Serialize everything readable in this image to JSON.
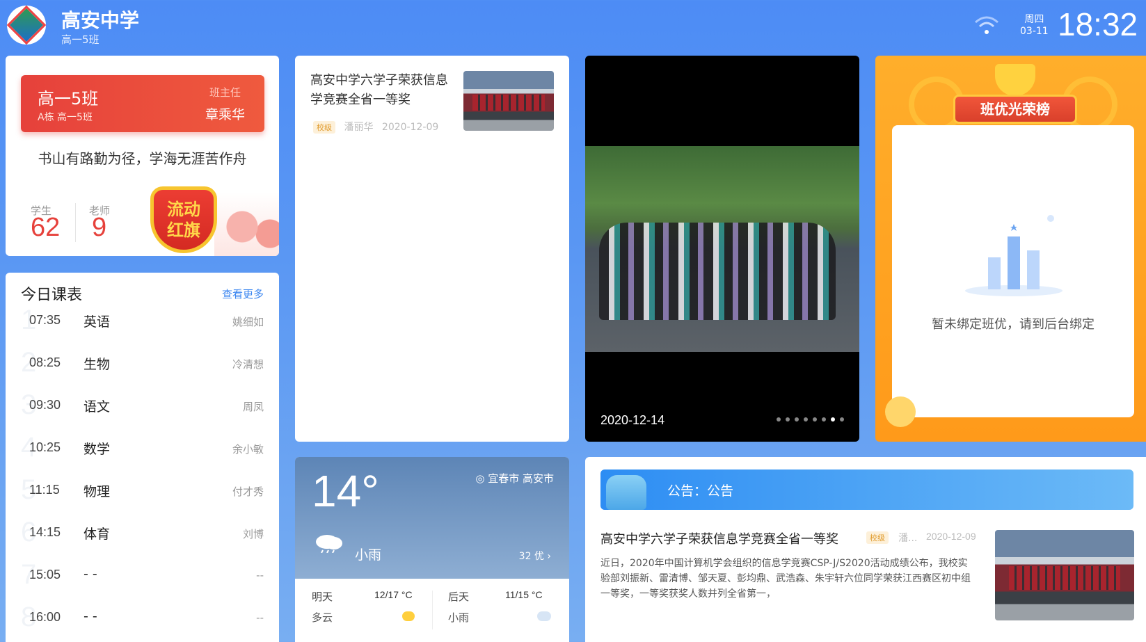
{
  "header": {
    "school_name": "高安中学",
    "class_name": "高一5班",
    "weekday": "周四",
    "date": "03-11",
    "time": "18:32"
  },
  "class_card": {
    "title": "高一5班",
    "location": "A栋 高一5班",
    "role_label": "班主任",
    "teacher": "章乘华",
    "motto": "书山有路勤为径，学海无涯苦作舟",
    "students_label": "学生",
    "students_count": "62",
    "teachers_label": "老师",
    "teachers_count": "9",
    "flag_line1": "流动",
    "flag_line2": "红旗"
  },
  "schedule": {
    "title": "今日课表",
    "more_label": "查看更多",
    "rows": [
      {
        "num": "1",
        "time": "07:35",
        "subject": "英语",
        "teacher": "姚细如"
      },
      {
        "num": "2",
        "time": "08:25",
        "subject": "生物",
        "teacher": "冷清想"
      },
      {
        "num": "3",
        "time": "09:30",
        "subject": "语文",
        "teacher": "周凤"
      },
      {
        "num": "4",
        "time": "10:25",
        "subject": "数学",
        "teacher": "余小敏"
      },
      {
        "num": "5",
        "time": "11:15",
        "subject": "物理",
        "teacher": "付才秀"
      },
      {
        "num": "6",
        "time": "14:15",
        "subject": "体育",
        "teacher": "刘博"
      },
      {
        "num": "7",
        "time": "15:05",
        "subject": "- -",
        "teacher": "--"
      },
      {
        "num": "8",
        "time": "16:00",
        "subject": "- -",
        "teacher": "--"
      }
    ]
  },
  "news": {
    "title": "高安中学六学子荣获信息学竞赛全省一等奖",
    "tag": "校级",
    "author": "潘丽华",
    "date": "2020-12-09"
  },
  "photo": {
    "date": "2020-12-14",
    "dot_count": 8,
    "active_dot": 6
  },
  "honor": {
    "banner": "班优光荣榜",
    "empty_text": "暂未绑定班优，请到后台绑定"
  },
  "weather": {
    "temp": "14°",
    "location": "宜春市 高安市",
    "condition": "小雨",
    "aqi": "32 优",
    "tomorrow_label": "明天",
    "tomorrow_temp": "12/17 °C",
    "tomorrow_cond": "多云",
    "after_label": "后天",
    "after_temp": "11/15 °C",
    "after_cond": "小雨"
  },
  "notice": {
    "label": "公告：公告",
    "title": "高安中学六学子荣获信息学竞赛全省一等奖",
    "tag": "校级",
    "author": "潘...",
    "date": "2020-12-09",
    "body": "近日，2020年中国计算机学会组织的信息学竞赛CSP-J/S2020活动成绩公布，我校实验部刘振新、雷清博、邹天夏、彭均鼎、武浩森、朱宇轩六位同学荣获江西赛区初中组一等奖，一等奖获奖人数并列全省第一，"
  },
  "colors": {
    "accent_red": "#e6413b",
    "accent_blue": "#3b86f0",
    "honor_orange": "#ffa424"
  }
}
